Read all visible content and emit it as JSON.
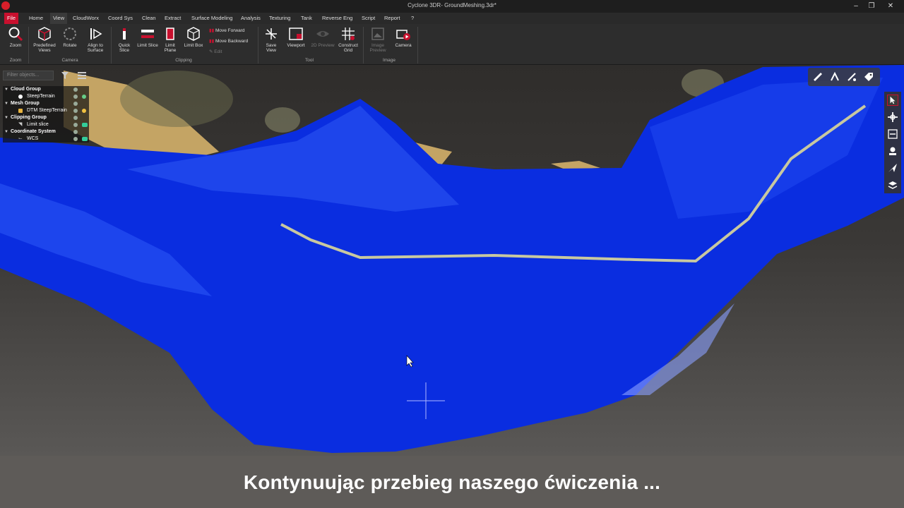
{
  "window": {
    "title": "Cyclone 3DR- GroundMeshing.3dr*",
    "minimize": "–",
    "restore": "❐",
    "close": "✕"
  },
  "menu": [
    "File",
    "Home",
    "View",
    "CloudWorx",
    "Coord Sys",
    "Clean",
    "Extract",
    "Surface Modeling",
    "Analysis",
    "Texturing",
    "Tank",
    "Reverse Eng",
    "Script",
    "Report",
    "?"
  ],
  "ribbon": {
    "zoom": "Zoom",
    "predefined_views": "Predefined Views",
    "rotate": "Rotate",
    "align_to_surface": "Align to Surface",
    "quick_slice": "Quick Slice",
    "limit_slice": "Limit Slice",
    "limit_plane": "Limit Plane",
    "limit_box": "Limit Box",
    "move_forward": "Move Forward",
    "move_backward": "Move Backward",
    "edit": "Edit",
    "save_view": "Save View",
    "viewport": "Viewport",
    "2d_preview": "2D Preview",
    "construct_grid": "Construct Grid",
    "image_preview": "Image Preview",
    "camera": "Camera",
    "groups": {
      "zoom": "Zoom",
      "camera": "Camera",
      "clipping": "Clipping",
      "tool": "Tool",
      "image": "Image"
    }
  },
  "filter": {
    "placeholder": "Filter objects..."
  },
  "tree": [
    {
      "label": "Cloud Group",
      "type": "group"
    },
    {
      "label": "SteepTerrain",
      "type": "child"
    },
    {
      "label": "Mesh Group",
      "type": "group"
    },
    {
      "label": "DTM SteepTerrain",
      "type": "child"
    },
    {
      "label": "Clipping Group",
      "type": "group"
    },
    {
      "label": "Limit slice",
      "type": "child"
    },
    {
      "label": "Coordinate System",
      "type": "group"
    },
    {
      "label": "WCS",
      "type": "child"
    }
  ],
  "colors": {
    "brand": "#c8102e",
    "mesh": "#0a2de0",
    "terrain": "#c4a464",
    "slice": "#c8c8a0"
  },
  "subtitle": "Kontynuując przebieg naszego ćwiczenia ..."
}
